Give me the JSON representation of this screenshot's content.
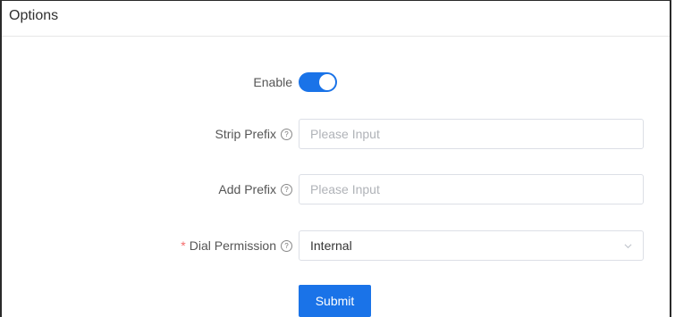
{
  "panel": {
    "title": "Options"
  },
  "form": {
    "enable": {
      "label": "Enable",
      "value": true
    },
    "strip_prefix": {
      "label": "Strip Prefix",
      "placeholder": "Please Input",
      "value": ""
    },
    "add_prefix": {
      "label": "Add Prefix",
      "placeholder": "Please Input",
      "value": ""
    },
    "dial_permission": {
      "required_mark": "*",
      "label": "Dial Permission",
      "value": "Internal"
    },
    "submit_label": "Submit"
  },
  "colors": {
    "accent": "#1a73e8",
    "required": "#f56c6c"
  },
  "icons": {
    "help": "question-circle-icon",
    "dropdown": "chevron-down-icon"
  }
}
